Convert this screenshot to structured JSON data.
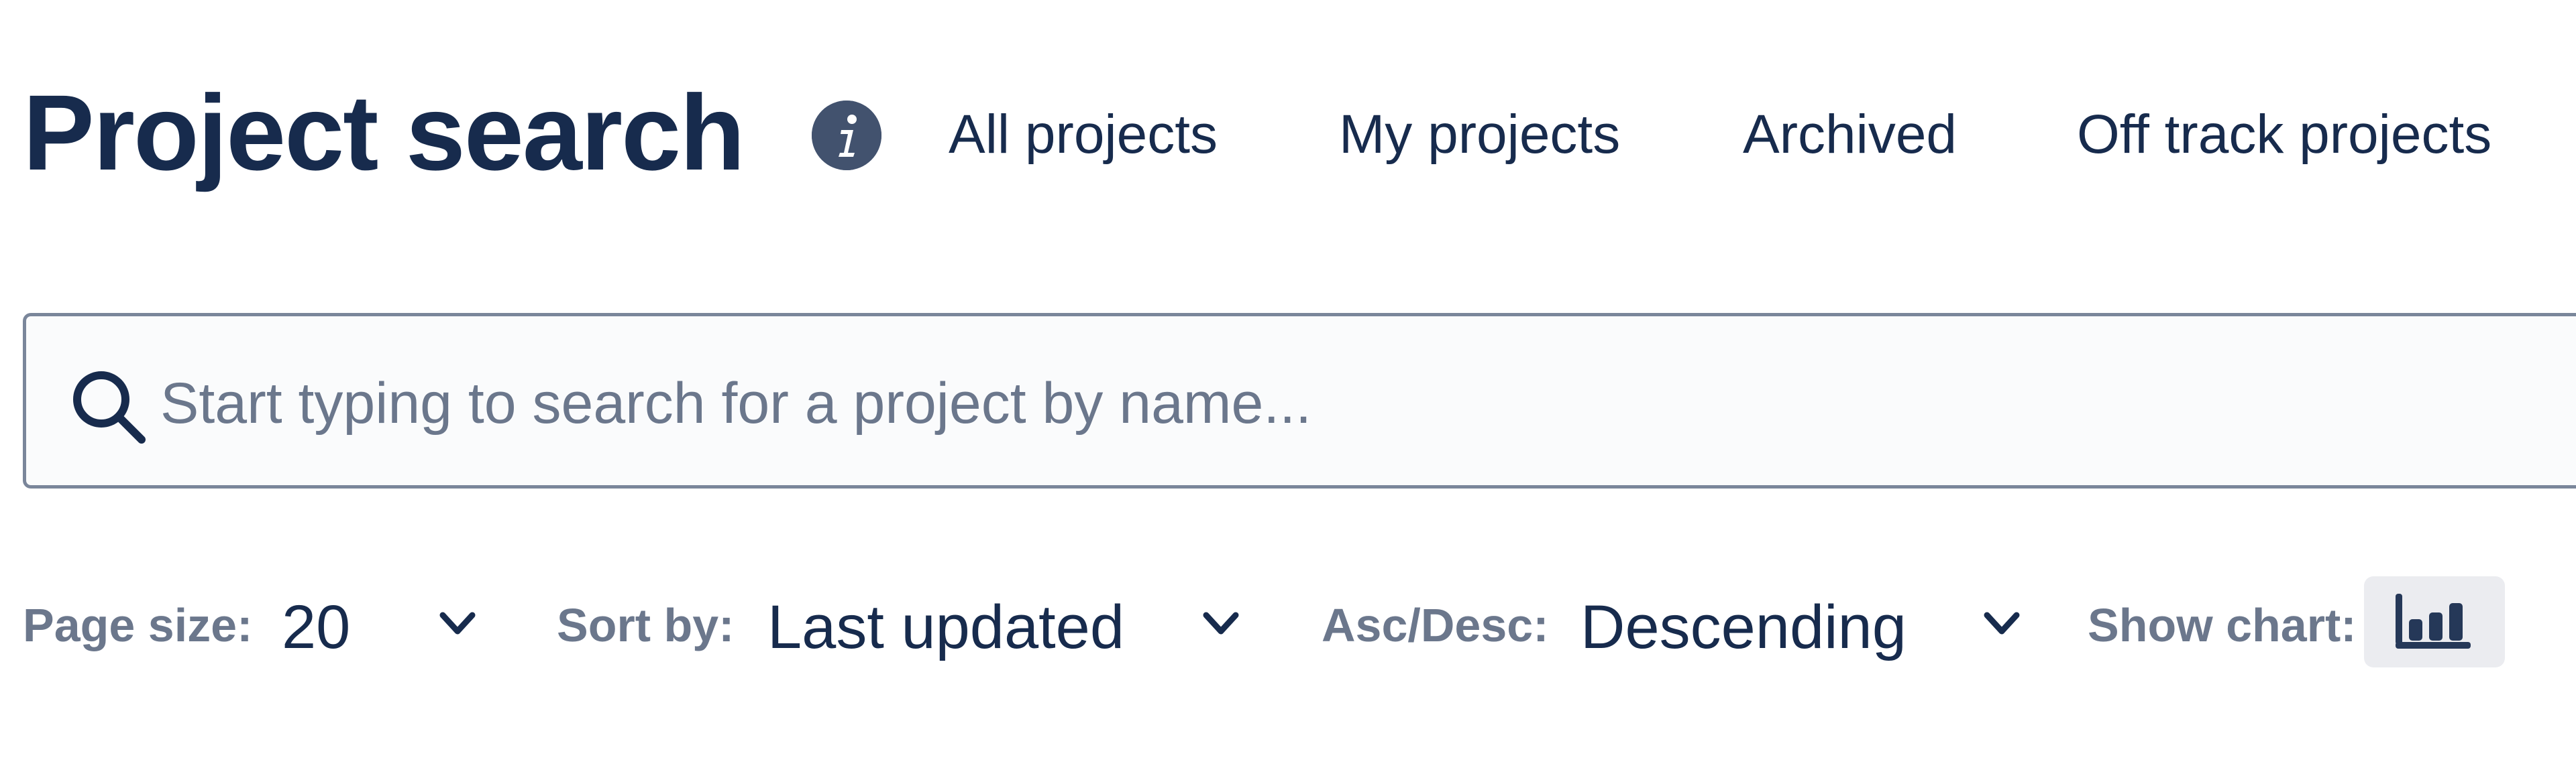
{
  "header": {
    "title": "Project search",
    "info_icon": "info-icon",
    "tabs": [
      {
        "label": "All projects"
      },
      {
        "label": "My projects"
      },
      {
        "label": "Archived"
      },
      {
        "label": "Off track projects"
      }
    ]
  },
  "search": {
    "icon": "search-icon",
    "value": "",
    "placeholder": "Start typing to search for a project by name..."
  },
  "controls": {
    "page_size": {
      "label": "Page size:",
      "value": "20"
    },
    "sort_by": {
      "label": "Sort by:",
      "value": "Last updated"
    },
    "order": {
      "label": "Asc/Desc:",
      "value": "Descending"
    },
    "show_chart": {
      "label": "Show chart:",
      "icon": "bar-chart-icon"
    }
  },
  "colors": {
    "text_primary": "#172b4d",
    "text_secondary": "#6b778c",
    "icon_bg": "#42526e",
    "input_border": "#7a869a",
    "input_bg": "#fafbfc",
    "button_bg": "#ebecf0"
  }
}
